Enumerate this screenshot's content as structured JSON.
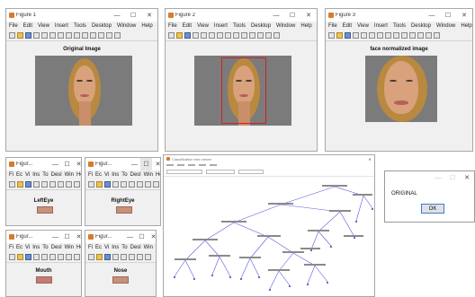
{
  "figure1": {
    "title": "Figure 1",
    "menu": [
      "File",
      "Edit",
      "View",
      "Insert",
      "Tools",
      "Desktop",
      "Window",
      "Help"
    ],
    "axes_title": "Original Image"
  },
  "figure2": {
    "title": "Figure 2",
    "menu": [
      "File",
      "Edit",
      "View",
      "Insert",
      "Tools",
      "Desktop",
      "Window",
      "Help"
    ]
  },
  "figure3": {
    "title": "Figure 3",
    "menu": [
      "File",
      "Edit",
      "View",
      "Insert",
      "Tools",
      "Desktop",
      "Window",
      "Help"
    ],
    "axes_title": "face normalized image"
  },
  "small_figures": [
    {
      "title": "Figur...",
      "menu": [
        "Fi",
        "Ec",
        "Vi",
        "Ins",
        "To",
        "Desl",
        "Win",
        "He"
      ],
      "label": "LeftEye"
    },
    {
      "title": "Figur...",
      "menu": [
        "Fi",
        "Ec",
        "Vi",
        "Ins",
        "To",
        "Desl",
        "Win",
        "He"
      ],
      "label": "RightEye"
    },
    {
      "title": "Figur...",
      "menu": [
        "Fi",
        "Ec",
        "Vi",
        "Ins",
        "To",
        "Desl",
        "Win",
        "He"
      ],
      "label": "Mouth"
    },
    {
      "title": "Figur...",
      "menu": [
        "Fi",
        "Ec",
        "Vi",
        "Ins",
        "To",
        "Desl",
        "Win",
        "He"
      ],
      "label": "Nose"
    }
  ],
  "tree_viewer": {
    "title": "Classification tree viewer"
  },
  "message_box": {
    "text": "ORIGINAL",
    "ok_label": "OK"
  },
  "window_controls": {
    "minimize": "—",
    "maximize": "☐",
    "close": "✕"
  },
  "colors": {
    "detection_box": "#d02020",
    "tree_lines": "#5a5adf"
  }
}
